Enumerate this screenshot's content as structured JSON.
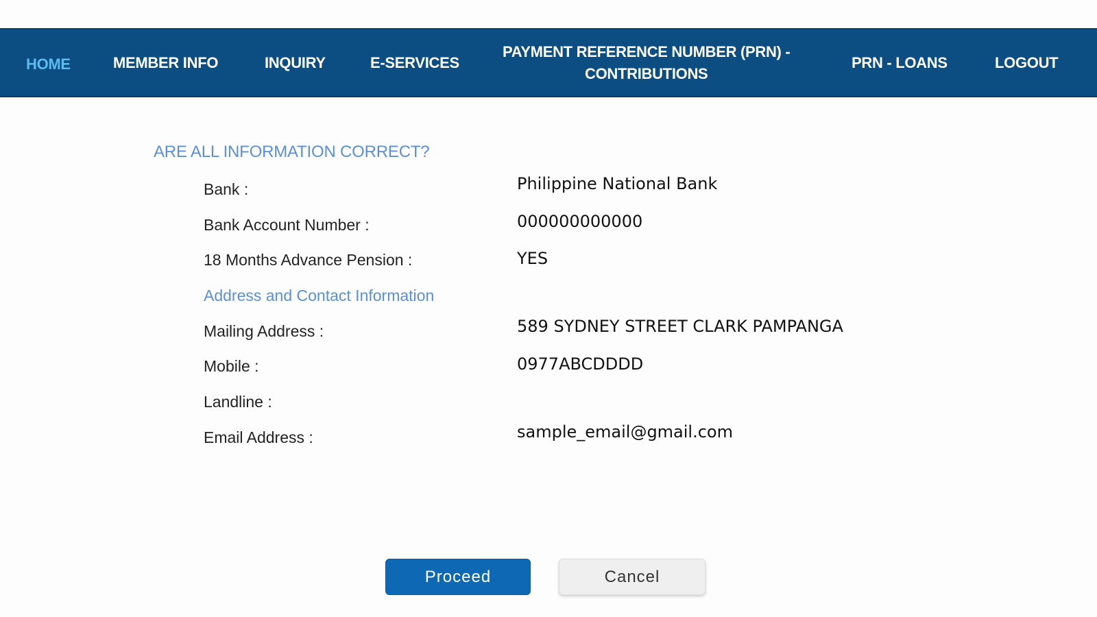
{
  "nav": {
    "items": [
      {
        "label": "HOME",
        "active": true
      },
      {
        "label": "MEMBER INFO"
      },
      {
        "label": "INQUIRY"
      },
      {
        "label": "E-SERVICES"
      },
      {
        "label_line1": "PAYMENT REFERENCE NUMBER (PRN) -",
        "label_line2": "CONTRIBUTIONS"
      },
      {
        "label": "PRN - LOANS"
      },
      {
        "label": "LOGOUT"
      }
    ]
  },
  "colors": {
    "navbar_bg": "#0c4d82",
    "nav_active": "#5bbcf0",
    "section_title": "#5b8fd9",
    "proceed_bg": "#0e68b3",
    "cancel_bg": "#efefef"
  },
  "confirm": {
    "title": "ARE ALL INFORMATION CORRECT?",
    "bank_fields": [
      {
        "label": "Bank :",
        "value": "Philippine National Bank"
      },
      {
        "label": "Bank Account Number :",
        "value": "000000000000"
      },
      {
        "label": "18 Months Advance Pension :",
        "value": "YES"
      }
    ],
    "address_section_title": "Address and Contact Information",
    "contact_fields": [
      {
        "label": "Mailing Address :",
        "value": "589 SYDNEY STREET CLARK PAMPANGA"
      },
      {
        "label": "Mobile :",
        "value": "0977ABCDDDD"
      },
      {
        "label": "Landline :",
        "value": ""
      },
      {
        "label": "Email Address :",
        "value": "sample_email@gmail.com"
      }
    ]
  },
  "actions": {
    "proceed_label": "Proceed",
    "cancel_label": "Cancel"
  }
}
